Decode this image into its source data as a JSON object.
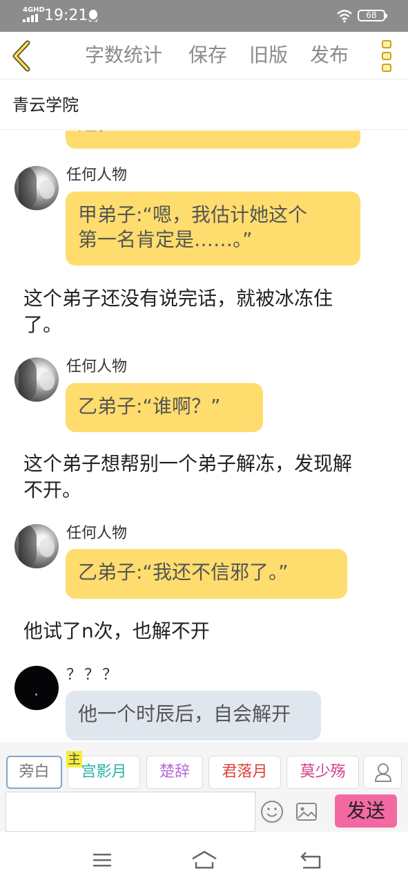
{
  "status_bar": {
    "network": "4GHD",
    "time": "19:21",
    "battery": "68"
  },
  "toolbar": {
    "word_count": "字数统计",
    "save": "保存",
    "old_version": "旧版",
    "publish": "发布"
  },
  "story": {
    "title": "青云学院"
  },
  "messages": [
    {
      "type": "bubble",
      "text": "短。",
      "partial": true
    },
    {
      "type": "character",
      "name": "任何人物",
      "text_line1": "甲弟子:“嗯，我估计她这个",
      "text_line2": "第一名肯定是……。”"
    },
    {
      "type": "narration",
      "line1": "这个弟子还没有说完话，就被冰冻住",
      "line2": "了。"
    },
    {
      "type": "character",
      "name": "任何人物",
      "text": "乙弟子:“谁啊？”"
    },
    {
      "type": "narration",
      "line1": "这个弟子想帮别一个弟子解冻，发现解",
      "line2": "不开。"
    },
    {
      "type": "character",
      "name": "任何人物",
      "text": "乙弟子:“我还不信邪了。”"
    },
    {
      "type": "narration",
      "line1": "他试了n次，也解不开"
    },
    {
      "type": "character",
      "name": "？？？",
      "text": "他一个时辰后，自会解开"
    }
  ],
  "characters_bar": {
    "chips": [
      {
        "label": "旁白",
        "color": "#777777"
      },
      {
        "label": "宫影月",
        "color": "#2bb3a6",
        "tag": "主"
      },
      {
        "label": "楚辞",
        "color": "#b86ad6"
      },
      {
        "label": "君落月",
        "color": "#e0403a"
      },
      {
        "label": "莫少殇",
        "color": "#d43c8c"
      }
    ]
  },
  "composer": {
    "input_value": "",
    "send": "发送"
  },
  "colors": {
    "status_bar": "#8c8c8c",
    "bubble_yellow": "#fedd6e",
    "bubble_grey": "#e0e6ee",
    "send_button": "#f36aa3",
    "menu_icon": "#c9a227"
  },
  "icons": [
    "back-chevron-icon",
    "more-menu-icon",
    "user-icon",
    "emoji-icon",
    "image-icon",
    "nav-menu-icon",
    "nav-home-icon",
    "nav-back-icon"
  ]
}
